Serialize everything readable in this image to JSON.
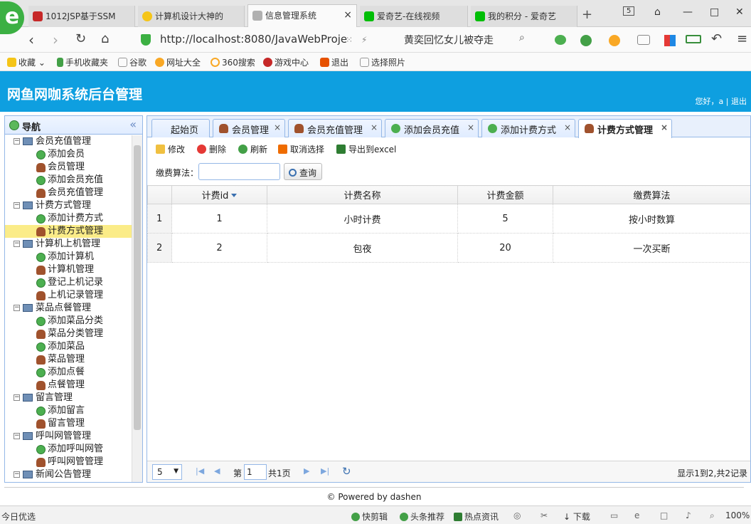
{
  "browser": {
    "tabs": [
      {
        "title": "1012JSP基于SSM",
        "icon": "red-square-icon"
      },
      {
        "title": "计算机设计大神的",
        "icon": "star-icon"
      },
      {
        "title": "信息管理系统",
        "icon": "page-icon",
        "close": "×"
      },
      {
        "title": "爱奇艺-在线视频",
        "icon": "iqiyi-icon"
      },
      {
        "title": "我的积分 - 爱奇艺",
        "icon": "iqiyi-icon"
      }
    ],
    "new_tab": "+",
    "tab_count": "5",
    "url": "http://localhost:8080/JavaWebProje",
    "hot_search": "黄奕回忆女儿被夺走",
    "bookmarks": [
      "收藏",
      "手机收藏夹",
      "谷歌",
      "网址大全",
      "360搜索",
      "游戏中心",
      "退出",
      "选择照片"
    ]
  },
  "app": {
    "title": "网鱼网咖系统后台管理",
    "greeting": "您好，a | 退出"
  },
  "nav": {
    "title": "导航",
    "collapse": "«",
    "groups": [
      {
        "label": "会员充值管理",
        "items": [
          "添加会员",
          "会员管理",
          "添加会员充值",
          "会员充值管理"
        ]
      },
      {
        "label": "计费方式管理",
        "items": [
          "添加计费方式",
          "计费方式管理"
        ]
      },
      {
        "label": "计算机上机管理",
        "items": [
          "添加计算机",
          "计算机管理",
          "登记上机记录",
          "上机记录管理"
        ]
      },
      {
        "label": "菜品点餐管理",
        "items": [
          "添加菜品分类",
          "菜品分类管理",
          "添加菜品",
          "菜品管理",
          "添加点餐",
          "点餐管理"
        ]
      },
      {
        "label": "留言管理",
        "items": [
          "添加留言",
          "留言管理"
        ]
      },
      {
        "label": "呼叫网管管理",
        "items": [
          "添加呼叫网管",
          "呼叫网管管理"
        ]
      },
      {
        "label": "新闻公告管理",
        "items": []
      }
    ],
    "selected": "计费方式管理"
  },
  "tabs": [
    {
      "label": "起始页",
      "closable": false
    },
    {
      "label": "会员管理",
      "closable": true
    },
    {
      "label": "会员充值管理",
      "closable": true
    },
    {
      "label": "添加会员充值",
      "closable": true
    },
    {
      "label": "添加计费方式",
      "closable": true
    },
    {
      "label": "计费方式管理",
      "closable": true,
      "active": true
    }
  ],
  "toolbar": {
    "edit": "修改",
    "delete": "删除",
    "refresh": "刷新",
    "cancel_select": "取消选择",
    "export": "导出到excel"
  },
  "search": {
    "label": "缴费算法：",
    "button": "查询",
    "value": ""
  },
  "grid": {
    "columns": [
      "",
      "计费id",
      "计费名称",
      "计费金额",
      "缴费算法"
    ],
    "rows": [
      {
        "rn": "1",
        "id": "1",
        "name": "小时计费",
        "amount": "5",
        "method": "按小时数算"
      },
      {
        "rn": "2",
        "id": "2",
        "name": "包夜",
        "amount": "20",
        "method": "一次买断"
      }
    ]
  },
  "pager": {
    "page_size": "5",
    "page_label": "第",
    "page": "1",
    "total_pages": "共1页",
    "info": "显示1到2,共2记录"
  },
  "footer": {
    "powered": "© Powered by dashen"
  },
  "statusbar": {
    "left": "今日优选",
    "items": [
      "快剪辑",
      "头条推荐",
      "热点资讯",
      "下载"
    ],
    "zoom": "100%"
  }
}
